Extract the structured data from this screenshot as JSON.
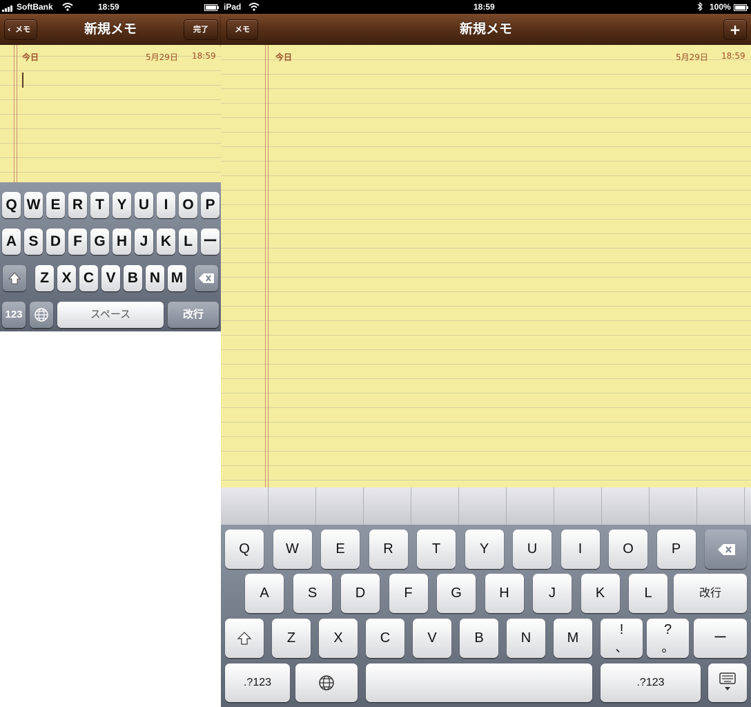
{
  "iphone": {
    "status": {
      "carrier": "SoftBank",
      "time": "18:59"
    },
    "nav": {
      "back_label": "メモ",
      "title": "新規メモ",
      "done_label": "完了"
    },
    "note": {
      "day": "今日",
      "date": "5月29日",
      "time": "18:59"
    },
    "keyboard": {
      "row1": [
        "Q",
        "W",
        "E",
        "R",
        "T",
        "Y",
        "U",
        "I",
        "O",
        "P"
      ],
      "row2": [
        "A",
        "S",
        "D",
        "F",
        "G",
        "H",
        "J",
        "K",
        "L",
        "ー"
      ],
      "row3": [
        "Z",
        "X",
        "C",
        "V",
        "B",
        "N",
        "M"
      ],
      "numbers_label": "123",
      "space_label": "スペース",
      "return_label": "改行"
    }
  },
  "ipad": {
    "status": {
      "device": "iPad",
      "time": "18:59",
      "battery": "100%"
    },
    "nav": {
      "memo_label": "メモ",
      "title": "新規メモ",
      "add_label": "+"
    },
    "note": {
      "day": "今日",
      "date": "5月29日",
      "time": "18:59"
    },
    "keyboard": {
      "row1": [
        "Q",
        "W",
        "E",
        "R",
        "T",
        "Y",
        "U",
        "I",
        "O",
        "P"
      ],
      "row2": [
        "A",
        "S",
        "D",
        "F",
        "G",
        "H",
        "J",
        "K",
        "L"
      ],
      "return_label": "改行",
      "row3": [
        "Z",
        "X",
        "C",
        "V",
        "B",
        "N",
        "M"
      ],
      "excl_top": "!",
      "excl_bottom": "、",
      "quest_top": "?",
      "quest_bottom": "。",
      "dash_label": "ー",
      "numbers_label": ".?123"
    }
  },
  "colors": {
    "navbar": "#5a3219",
    "paper": "#f4eda0",
    "date_text": "#9b4f2a",
    "keyboard_bg": "#8e96a3"
  }
}
